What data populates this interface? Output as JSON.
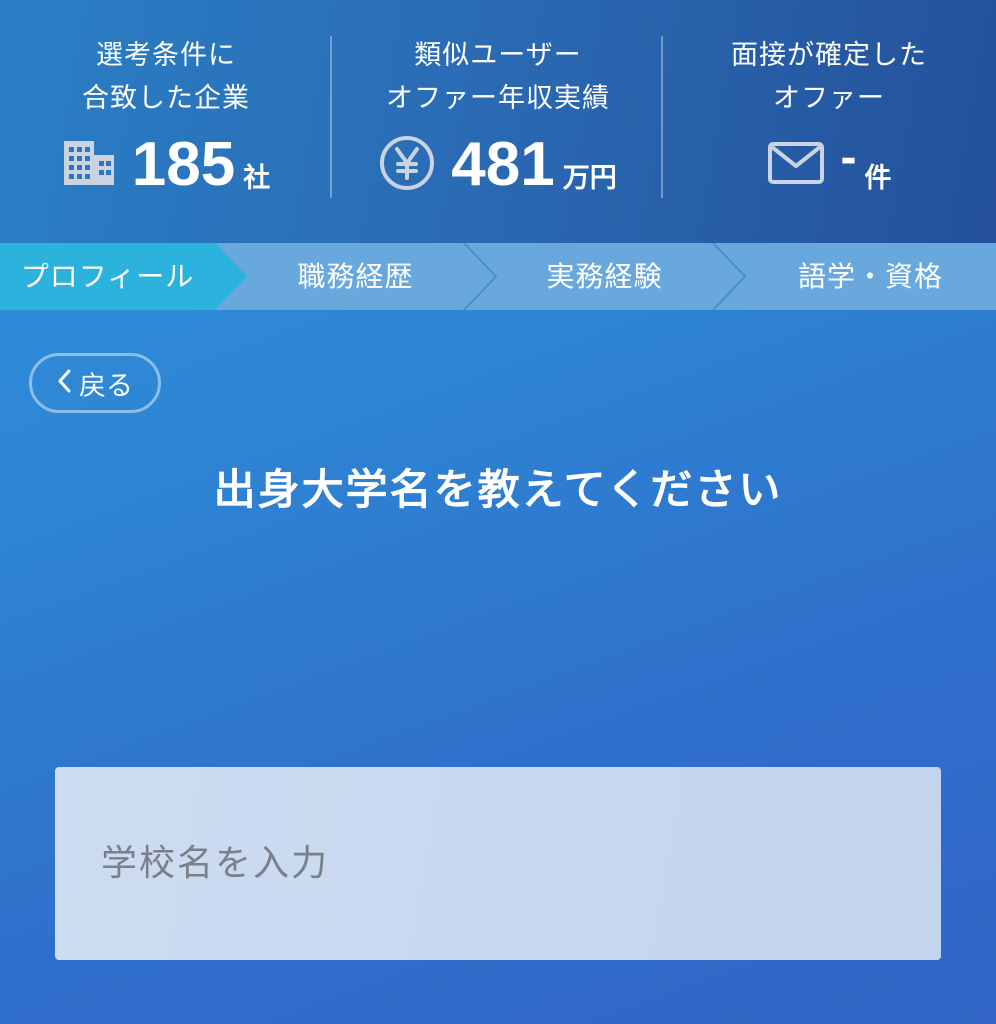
{
  "stats": [
    {
      "label": "選考条件に\n合致した企業",
      "value": "185",
      "unit": "社",
      "icon": "building-icon"
    },
    {
      "label": "類似ユーザー\nオファー年収実績",
      "value": "481",
      "unit": "万円",
      "icon": "yen-icon"
    },
    {
      "label": "面接が確定した\nオファー",
      "value": "-",
      "unit": "件",
      "icon": "mail-icon"
    }
  ],
  "steps": [
    {
      "label": "プロフィール",
      "active": true
    },
    {
      "label": "職務経歴",
      "active": false
    },
    {
      "label": "実務経験",
      "active": false
    },
    {
      "label": "語学・資格",
      "active": false
    }
  ],
  "back": {
    "label": "戻る",
    "icon": "chevron-left-icon"
  },
  "title": "出身大学名を教えてください",
  "school_input": {
    "placeholder": "学校名を入力",
    "value": ""
  },
  "colors": {
    "header_start": "#2a7fc6",
    "header_end": "#24509a",
    "step_active": "#2bb3dd",
    "step_inactive": "#69a8dd",
    "background_start": "#2f93db",
    "background_end": "#3265c5",
    "input_bg": "#c7d7ef",
    "icon_gray": "#c9d3e2"
  }
}
